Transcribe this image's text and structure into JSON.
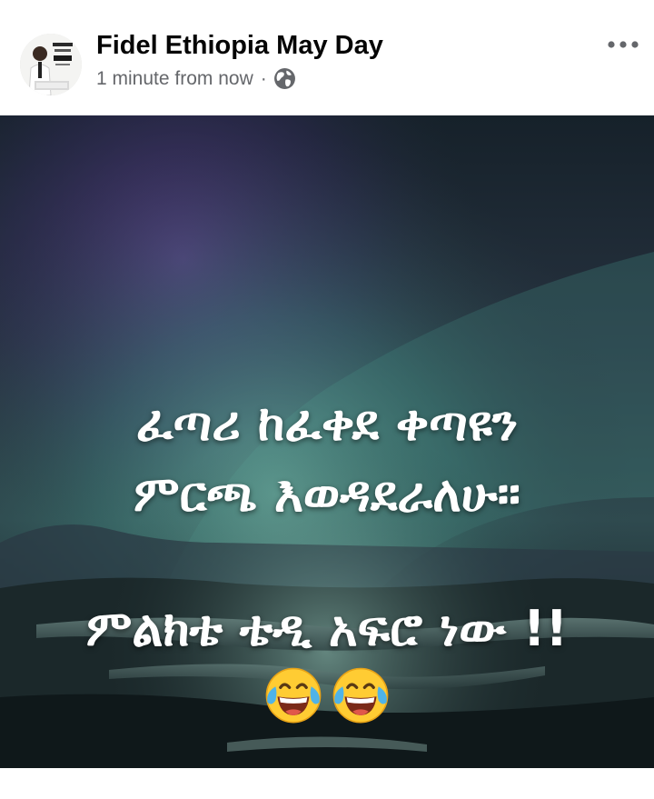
{
  "post": {
    "author": "Fidel Ethiopia May Day",
    "timestamp": "1 minute from now",
    "separator": "·",
    "privacy_icon": "globe-icon",
    "more_icon": "more-horizontal-icon",
    "avatar_icon": "profile-avatar"
  },
  "image": {
    "caption_line_1": "ፈጣሪ ከፈቀደ ቀጣዩን",
    "caption_line_2": "ምርጫ እወዳደራለሁ።",
    "caption_line_3": "ምልክቴ ቴዲ አፍሮ ነው !!",
    "emojis": [
      "face-with-tears-of-joy-icon",
      "face-with-tears-of-joy-icon"
    ]
  },
  "colors": {
    "text_primary": "#050505",
    "text_secondary": "#65676b",
    "caption": "#ffffff"
  }
}
